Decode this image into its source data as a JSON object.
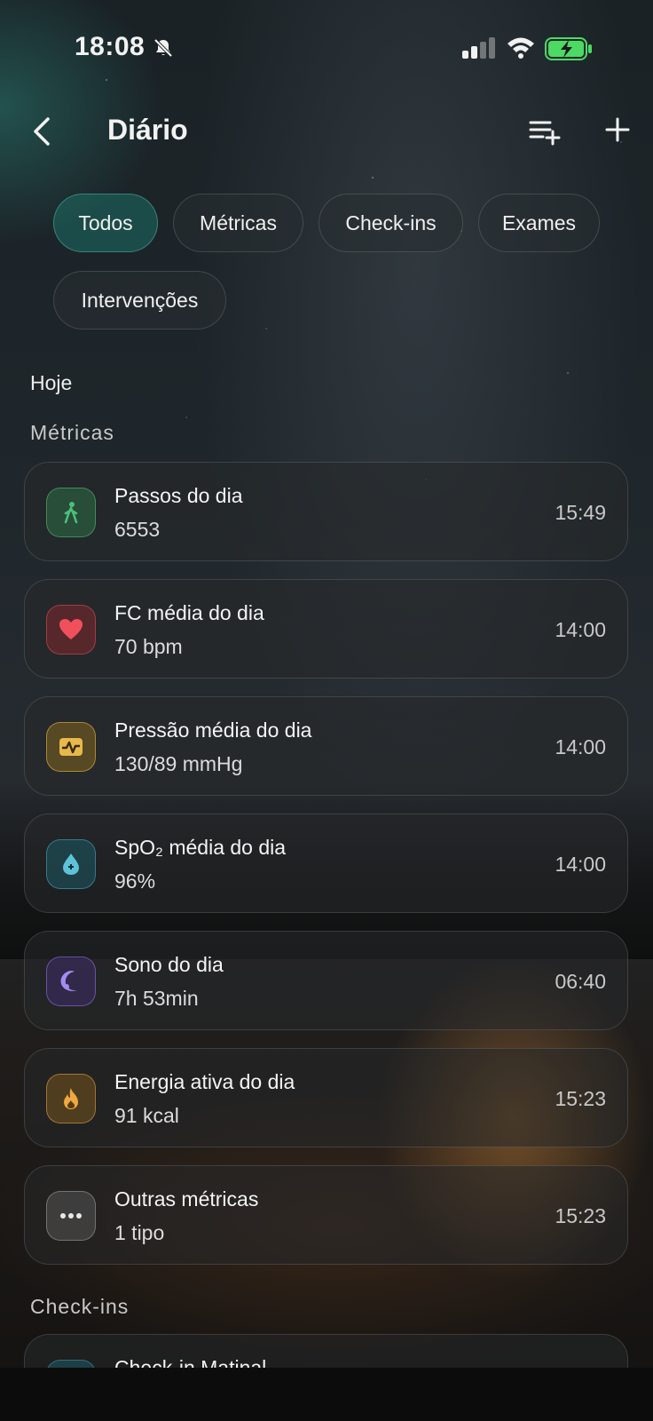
{
  "status_bar": {
    "time": "18:08"
  },
  "header": {
    "title": "Diário"
  },
  "filters": [
    {
      "label": "Todos",
      "active": true
    },
    {
      "label": "Métricas",
      "active": false
    },
    {
      "label": "Check-ins",
      "active": false
    },
    {
      "label": "Exames",
      "active": false
    },
    {
      "label": "Intervenções",
      "active": false
    }
  ],
  "sections": {
    "today": "Hoje",
    "metrics": "Métricas",
    "checkins": "Check-ins"
  },
  "metrics": [
    {
      "title": "Passos do dia",
      "value": "6553",
      "time": "15:49",
      "icon": "walking-icon",
      "color": "#4cc07a"
    },
    {
      "title": "FC média do dia",
      "value": "70 bpm",
      "time": "14:00",
      "icon": "heart-icon",
      "color": "#f0505c"
    },
    {
      "title": "Pressão média do dia",
      "value": "130/89 mmHg",
      "time": "14:00",
      "icon": "pulse-icon",
      "color": "#e8b84a"
    },
    {
      "title": "SpO₂ média do dia",
      "value": "96%",
      "time": "14:00",
      "icon": "drop-icon",
      "color": "#5ec3d8"
    },
    {
      "title": "Sono do dia",
      "value": "7h 53min",
      "time": "06:40",
      "icon": "moon-icon",
      "color": "#a58cf0"
    },
    {
      "title": "Energia ativa do dia",
      "value": "91 kcal",
      "time": "15:23",
      "icon": "flame-icon",
      "color": "#f0a840"
    },
    {
      "title": "Outras métricas",
      "value": "1 tipo",
      "time": "15:23",
      "icon": "more-icon",
      "color": "#e0e0e0"
    }
  ],
  "checkins": [
    {
      "title": "Check-in Matinal"
    }
  ]
}
